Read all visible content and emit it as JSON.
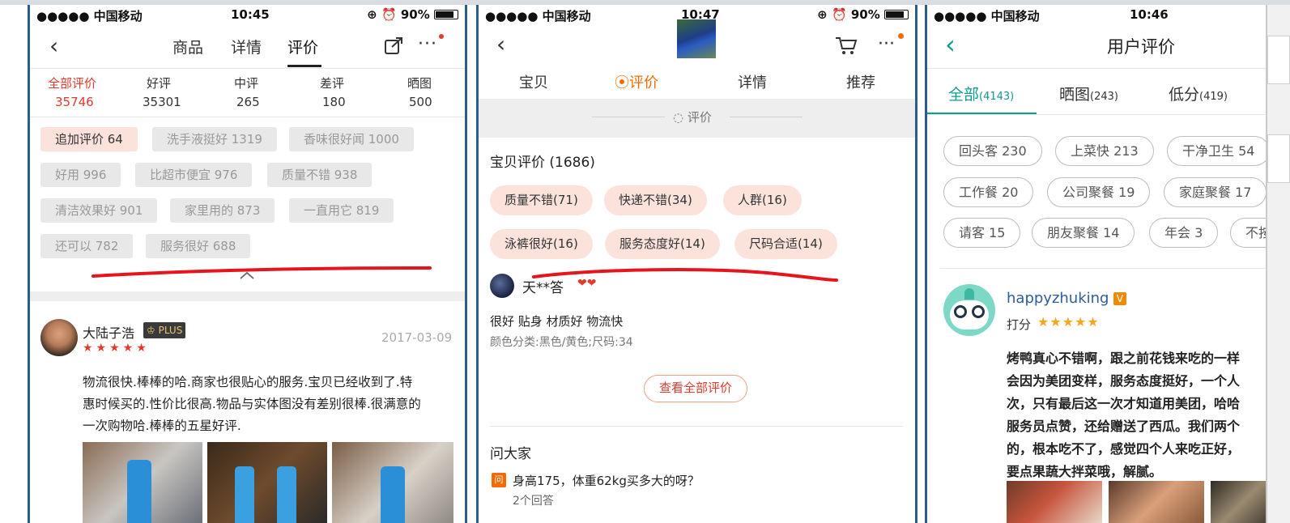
{
  "status_bars": {
    "p1": {
      "carrier": "●●●●● 中国移动",
      "time": "10:45",
      "battery": "90%"
    },
    "p2": {
      "carrier": "●●●●● 中国移动",
      "time": "10:47",
      "battery": "90%"
    },
    "p3": {
      "carrier": "●●●●● 中国移动",
      "time": "10:46"
    }
  },
  "phone1": {
    "nav_tabs": [
      "商品",
      "详情",
      "评价"
    ],
    "stats": [
      {
        "label": "全部评价",
        "count": "35746"
      },
      {
        "label": "好评",
        "count": "35301"
      },
      {
        "label": "中评",
        "count": "265"
      },
      {
        "label": "差评",
        "count": "180"
      },
      {
        "label": "晒图",
        "count": "500"
      }
    ],
    "tags": [
      "追加评价 64",
      "洗手液挺好 1319",
      "香味很好闻 1000",
      "好用 996",
      "比超市便宜 976",
      "质量不错 938",
      "清洁效果好 901",
      "家里用的 873",
      "一直用它 819",
      "还可以 782",
      "服务很好 688"
    ],
    "review": {
      "username": "大陆子浩",
      "badge": "PLUS",
      "date": "2017-03-09",
      "stars": "★★★★★",
      "text": [
        "物流很快.棒棒的哈.商家也很贴心的服务.宝贝已经收到了.特",
        "惠时候买的.性价比很高.物品与实体图没有差别很棒.很满意的",
        "一次购物哈.棒棒的五星好评."
      ]
    }
  },
  "phone2": {
    "nav_tabs": [
      "宝贝",
      "评价",
      "详情",
      "推荐"
    ],
    "section_label": "评价",
    "review_header": "宝贝评价 (1686)",
    "tags": [
      "质量不错(71)",
      "快递不错(34)",
      "人群(16)",
      "泳裤很好(16)",
      "服务态度好(14)",
      "尺码合适(14)"
    ],
    "review": {
      "username": "天**答",
      "text": "很好 贴身 材质好 物流快",
      "spec": "颜色分类:黑色/黄色;尺码:34"
    },
    "view_all_label": "查看全部评价",
    "qa_title": "问大家",
    "qa_badge": "问",
    "question": "身高175，体重62kg买多大的呀？",
    "answers": "2个回答"
  },
  "phone3": {
    "title": "用户评价",
    "tabs": [
      {
        "label": "全部",
        "count": "(4143)"
      },
      {
        "label": "晒图",
        "count": "(243)"
      },
      {
        "label": "低分",
        "count": "(419)"
      }
    ],
    "tags": [
      "回头客 230",
      "上菜快 213",
      "干净卫生 54",
      "工作餐 20",
      "公司聚餐 19",
      "家庭聚餐 17",
      "请客 15",
      "朋友聚餐 14",
      "年会 3",
      "不按"
    ],
    "review": {
      "username": "happyzhuking",
      "score_label": "打分",
      "stars": "★★★★★",
      "text": [
        "烤鸭真心不错啊，跟之前花钱来吃的一样",
        "会因为美团变样，服务态度挺好，一个人",
        "次，只有最后这一次才知道用美团，哈哈",
        "服务员点赞，还给赠送了西瓜。我们两个",
        "的，根本吃不了，感觉四个人来吃正好，",
        "要点果蔬大拌菜哦，解腻。"
      ]
    }
  },
  "colors": {
    "accent_red": "#e4392b",
    "orange": "#f56a00",
    "teal": "#0f9c8c",
    "frame_blue": "#2b5d8f"
  }
}
